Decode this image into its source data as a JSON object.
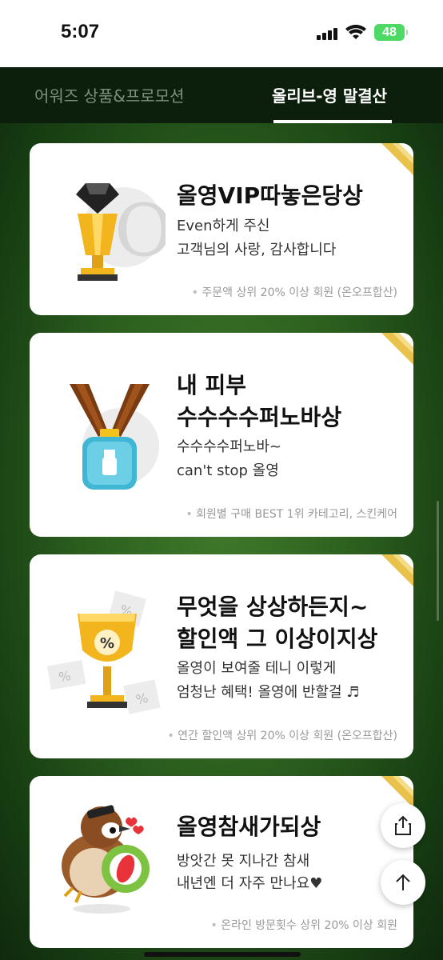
{
  "status_bar": {
    "time": "5:07",
    "battery": "48"
  },
  "tabs": [
    {
      "label": "어워즈 상품&프로모션",
      "active": false
    },
    {
      "label": "올리브-영 말결산",
      "active": true
    }
  ],
  "cards": [
    {
      "title_lines": [
        "올영VIP따놓은당상"
      ],
      "desc_lines": [
        "Even하게 주신",
        "고객님의 사랑, 감사합니다"
      ],
      "note": "주문액 상위 20% 이상 회원 (온오프합산)"
    },
    {
      "title_lines": [
        "내 피부",
        "수수수수퍼노바상"
      ],
      "desc_lines": [
        "수수수수퍼노바~",
        "can't stop 올영"
      ],
      "note": "회원별 구매 BEST 1위 카테고리, 스킨케어"
    },
    {
      "title_lines": [
        "무엇을 상상하든지~",
        "할인액 그 이상이지상"
      ],
      "desc_lines": [
        "올영이 보여줄 테니 이렇게",
        "엄청난 혜택! 올영에 반할걸 ♬"
      ],
      "note": "연간 할인액 상위 20% 이상 회원 (온오프합산)"
    },
    {
      "title_lines": [
        "올영참새가되상"
      ],
      "desc_lines": [
        "방앗간 못 지나간 참새",
        "내년엔 더 자주 만나요♥"
      ],
      "note": "온라인 방문횟수 상위 20% 이상 회원"
    }
  ],
  "colors": {
    "accent_green": "#2b5e1e",
    "ribbon_gold": "#e8c24a"
  }
}
